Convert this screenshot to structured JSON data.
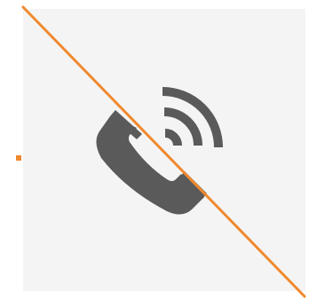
{
  "icon": {
    "name": "phone-signal-off-icon",
    "color": "#5a5a5a",
    "background": "#f4f4f4"
  },
  "strike": {
    "color": "#f0892e"
  },
  "marker": {
    "color": "#f0892e"
  }
}
